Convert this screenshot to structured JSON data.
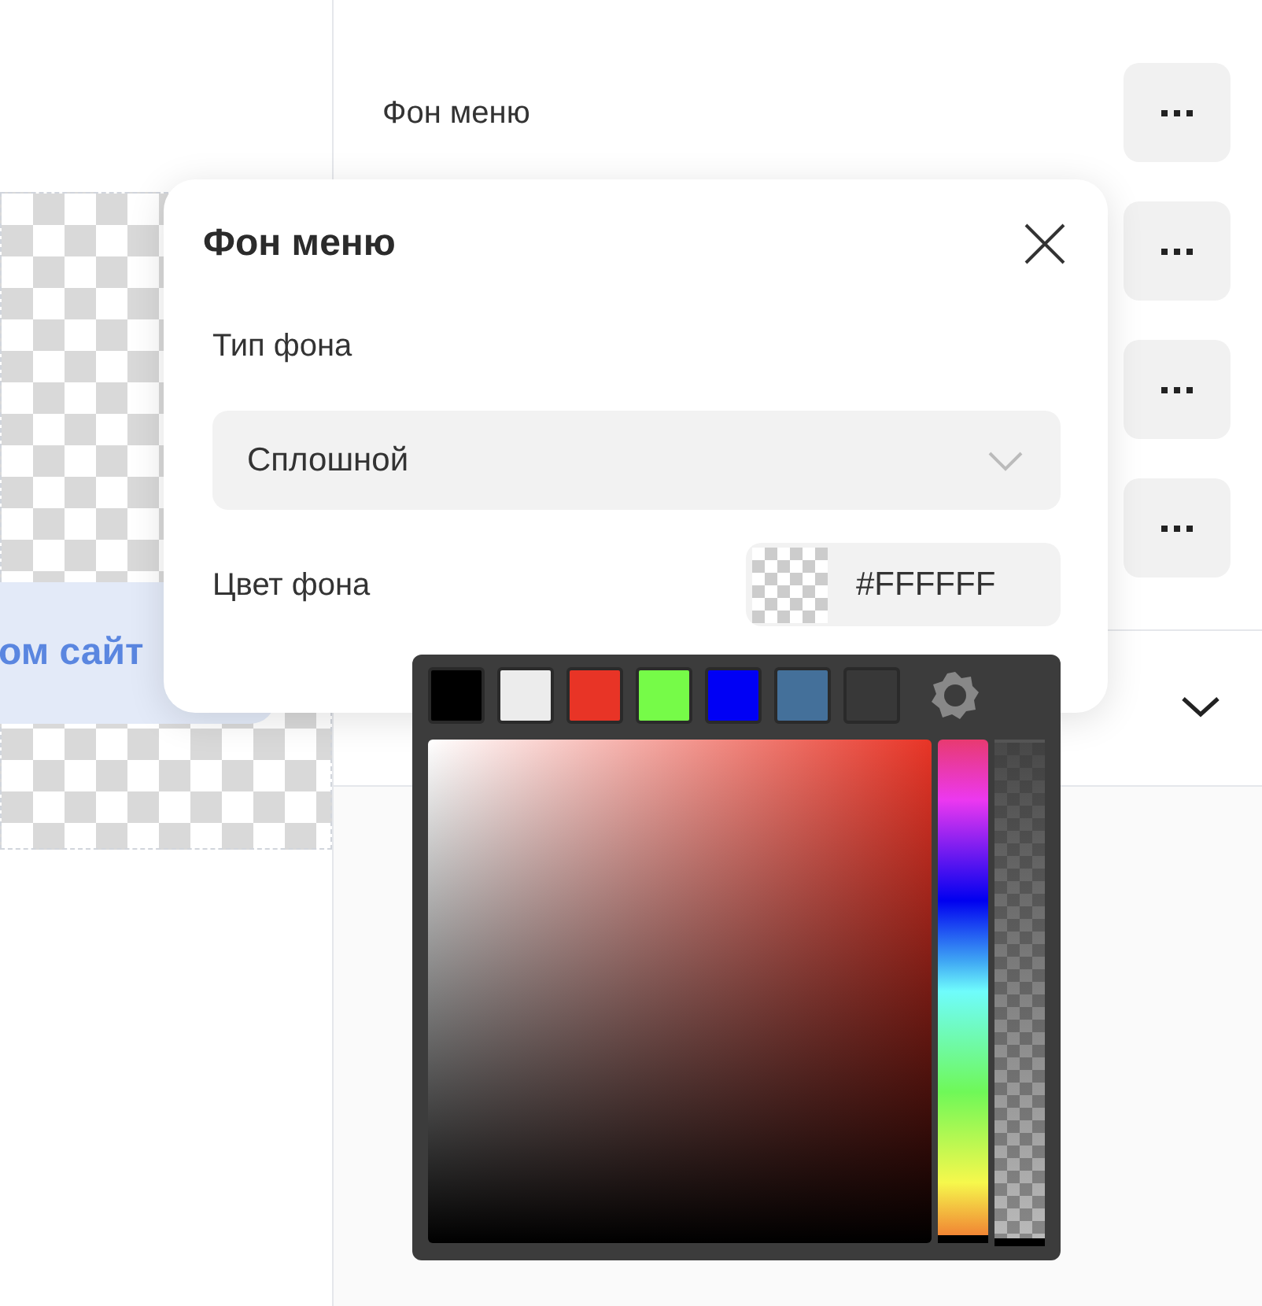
{
  "canvas": {
    "button_text": "ом сайт"
  },
  "panel": {
    "rows": [
      {
        "kind": "labeled",
        "label": "Фон меню"
      },
      {
        "kind": "covered"
      },
      {
        "kind": "covered"
      },
      {
        "kind": "covered"
      }
    ],
    "section": {
      "expanded": false
    }
  },
  "dialog": {
    "title": "Фон меню",
    "type_label": "Тип фона",
    "type_value": "Сплошной",
    "color_label": "Цвет фона",
    "color_value": "#FFFFFF"
  },
  "picker": {
    "hue": {
      "level": 1
    },
    "alpha": {
      "level": 1
    },
    "swatches": [
      {
        "color": "#000000"
      },
      {
        "color": "#ececec"
      },
      {
        "color": "#e83426"
      },
      {
        "color": "#76fb48"
      },
      {
        "color": "#0000f5"
      },
      {
        "color": "#44709a"
      },
      {
        "color": "#383838"
      }
    ]
  }
}
